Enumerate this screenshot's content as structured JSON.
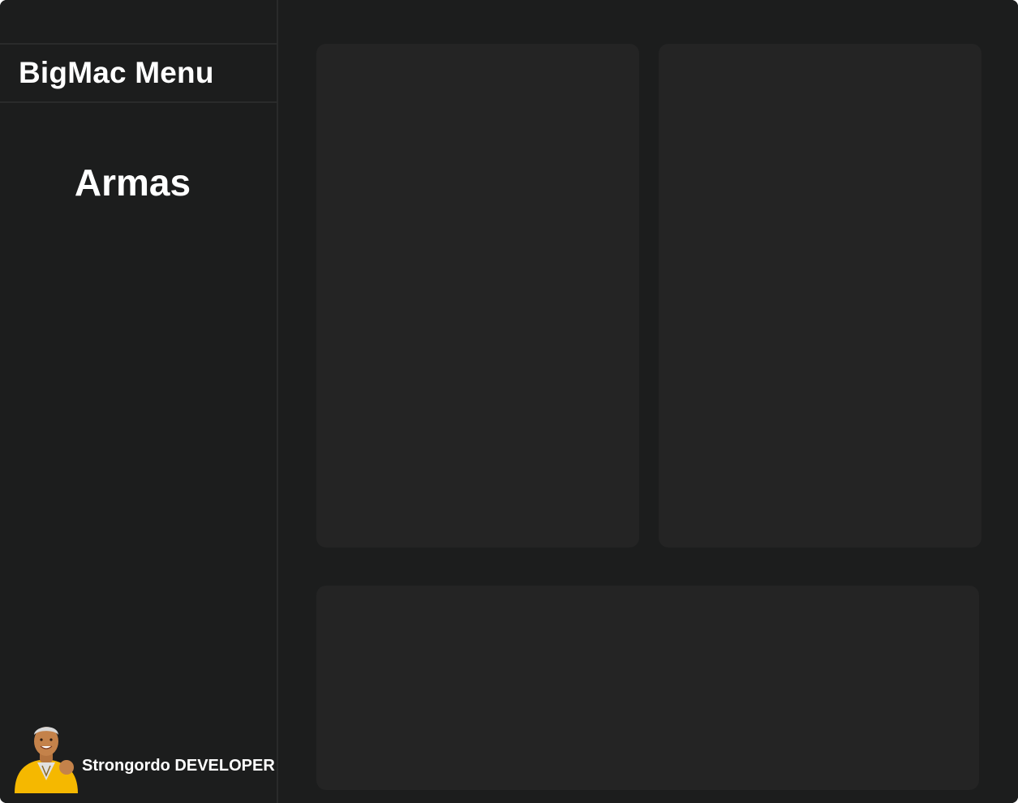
{
  "app": {
    "title": "BigMac Menu"
  },
  "sidebar": {
    "section_title": "Armas"
  },
  "user": {
    "name": "Strongordo DEVELOPER",
    "avatar_icon": "user-avatar-icon"
  },
  "colors": {
    "background": "#1c1d1d",
    "panel": "#242424",
    "divider": "#2a2b2b",
    "text": "#ffffff",
    "avatar_accent": "#f5b800"
  }
}
